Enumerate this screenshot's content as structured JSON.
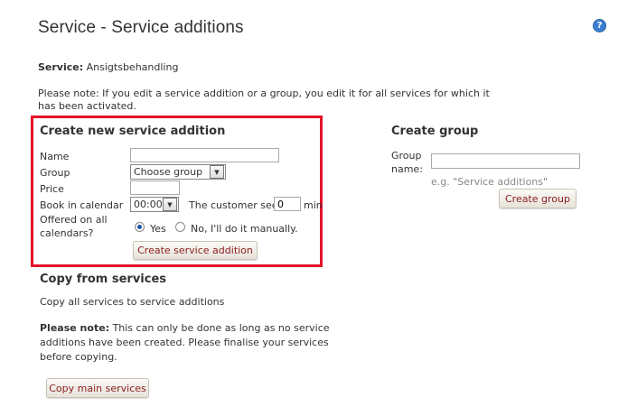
{
  "page": {
    "title": "Service - Service additions",
    "help_icon": "?"
  },
  "service": {
    "label": "Service:",
    "value": "Ansigtsbehandling"
  },
  "note": "Please note: If you edit a service addition or a group, you edit it for all services for which it has been activated.",
  "create_addition": {
    "heading": "Create new service addition",
    "name_label": "Name",
    "name_value": "",
    "group_label": "Group",
    "group_selected": "Choose group",
    "price_label": "Price",
    "price_value": "",
    "book_label": "Book in calendar",
    "book_value": "00:00",
    "customer_sees_label": "The customer sees",
    "customer_sees_value": "0",
    "min_label": "min",
    "offered_label": "Offered on all calendars?",
    "yes_label": "Yes",
    "no_label": "No, I'll do it manually.",
    "selected_option": "yes",
    "submit_label": "Create service addition"
  },
  "create_group": {
    "heading": "Create group",
    "name_label": "Group name:",
    "name_value": "",
    "hint": "e.g. \"Service additions\"",
    "submit_label": "Create group"
  },
  "copy": {
    "heading": "Copy from services",
    "description": "Copy all services to service additions",
    "note_bold": "Please note:",
    "note_text": "This can only be done as long as no service additions have been created. Please finalise your services before copying.",
    "button_label": "Copy main services"
  },
  "colors": {
    "highlight_border": "#e4132a",
    "button_text": "#8a1d1d",
    "help_icon": "#3a7fd0"
  }
}
